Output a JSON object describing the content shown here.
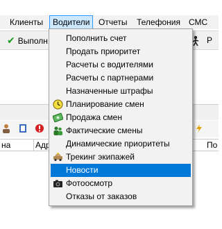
{
  "menubar": {
    "items": [
      "Клиенты",
      "Водители",
      "Отчеты",
      "Телефония",
      "СМС"
    ],
    "active": "Водители"
  },
  "toolbar": {
    "execute_label": "Выполн",
    "right_label": "Р"
  },
  "grid": {
    "columns": [
      "на",
      "Адр",
      "По"
    ]
  },
  "dropdown": {
    "items": [
      {
        "label": "Пополнить счет",
        "icon": ""
      },
      {
        "label": "Продать приоритет",
        "icon": ""
      },
      {
        "label": "Расчеты с водителями",
        "icon": ""
      },
      {
        "label": "Расчеты с партнерами",
        "icon": ""
      },
      {
        "label": "Назначенные штрафы",
        "icon": ""
      },
      {
        "label": "Планирование смен",
        "icon": "clock-icon"
      },
      {
        "label": "Продажа смен",
        "icon": "money-icon"
      },
      {
        "label": "Фактические смены",
        "icon": "people-icon"
      },
      {
        "label": "Динамические приоритеты",
        "icon": ""
      },
      {
        "label": "Трекинг экипажей",
        "icon": "taxi-icon"
      },
      {
        "label": "Новости",
        "icon": "",
        "selected": true
      },
      {
        "label": "Фотоосмотр",
        "icon": "camera-icon"
      },
      {
        "label": "Отказы от заказов",
        "icon": ""
      }
    ]
  },
  "colors": {
    "selection": "#0078d7",
    "menu_active_bg": "#cce8ff",
    "menu_active_border": "#3399ff",
    "checkmark": "#1a9a1a"
  }
}
